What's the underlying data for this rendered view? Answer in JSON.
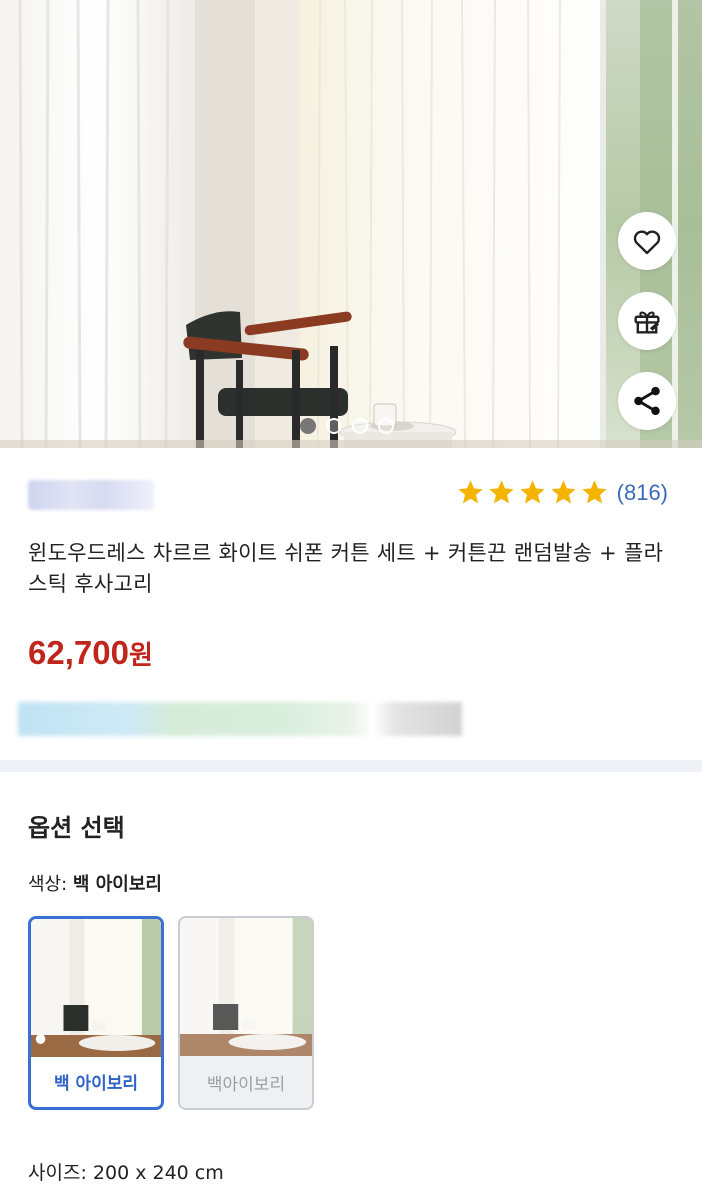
{
  "hero": {
    "slide_count": 4,
    "active_slide": 1,
    "actions": [
      {
        "icon": "heart-icon"
      },
      {
        "icon": "gift-icon"
      },
      {
        "icon": "share-icon"
      }
    ]
  },
  "product": {
    "rating_stars": 5,
    "rating_count": "(816)",
    "title": "윈도우드레스 차르르 화이트 쉬폰 커튼 세트 + 커튼끈 랜덤발송 + 플라스틱 후사고리",
    "price": "62,700",
    "price_unit": "원"
  },
  "options": {
    "section_title": "옵션 선택",
    "color_label": "색상:",
    "color_value": "백 아이보리",
    "swatches": [
      {
        "label": "백 아이보리",
        "selected": true
      },
      {
        "label": "백아이보리",
        "selected": false
      }
    ],
    "size_label": "사이즈:",
    "size_value": "200 x 240 cm"
  },
  "colors": {
    "price": "#c0261b",
    "rating_count": "#3b6bb8",
    "star": "#f4b400",
    "selected_border": "#3a6fd4"
  }
}
